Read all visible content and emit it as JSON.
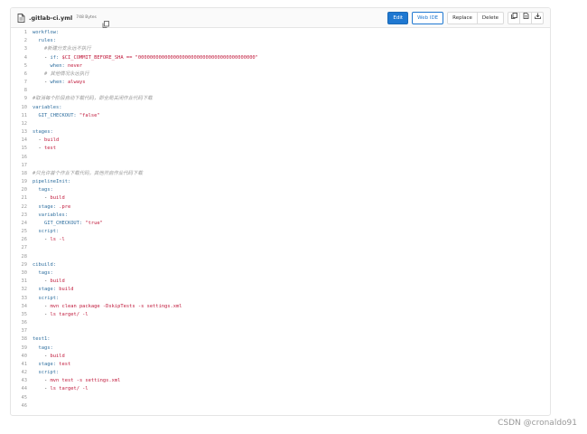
{
  "file": {
    "name": ".gitlab-ci.yml",
    "size": "748 Bytes"
  },
  "toolbar": {
    "edit_label": "Edit",
    "webide_label": "Web IDE",
    "replace_label": "Replace",
    "delete_label": "Delete"
  },
  "code_lines": [
    [
      {
        "t": "workflow:",
        "c": "k"
      }
    ],
    [
      {
        "t": "  rules:",
        "c": "k"
      }
    ],
    [
      {
        "t": "    #新建分支永远不执行",
        "c": "c"
      }
    ],
    [
      {
        "t": "    - ",
        "c": "p"
      },
      {
        "t": "if:",
        "c": "k"
      },
      {
        "t": " $CI_COMMIT_BEFORE_SHA == \"0000000000000000000000000000000000000000\"",
        "c": "s"
      }
    ],
    [
      {
        "t": "      when:",
        "c": "k"
      },
      {
        "t": " never",
        "c": "s"
      }
    ],
    [
      {
        "t": "    # 其他情况永远执行",
        "c": "c"
      }
    ],
    [
      {
        "t": "    - ",
        "c": "p"
      },
      {
        "t": "when:",
        "c": "k"
      },
      {
        "t": " always",
        "c": "s"
      }
    ],
    [
      {
        "t": "",
        "c": "p"
      }
    ],
    [
      {
        "t": "#取消每个阶段自动下载代码，即全局关闭作业代码下载",
        "c": "c"
      }
    ],
    [
      {
        "t": "variables:",
        "c": "k"
      }
    ],
    [
      {
        "t": "  GIT_CHECKOUT:",
        "c": "k"
      },
      {
        "t": " \"false\"",
        "c": "s"
      }
    ],
    [
      {
        "t": "",
        "c": "p"
      }
    ],
    [
      {
        "t": "stages:",
        "c": "k"
      }
    ],
    [
      {
        "t": "  - ",
        "c": "p"
      },
      {
        "t": "build",
        "c": "s"
      }
    ],
    [
      {
        "t": "  - ",
        "c": "p"
      },
      {
        "t": "test",
        "c": "s"
      }
    ],
    [
      {
        "t": "",
        "c": "p"
      }
    ],
    [
      {
        "t": "",
        "c": "p"
      }
    ],
    [
      {
        "t": "#只允许首个作业下载代码，其他开启作业代码下载",
        "c": "c"
      }
    ],
    [
      {
        "t": "pipelineInit:",
        "c": "k"
      }
    ],
    [
      {
        "t": "  tags:",
        "c": "k"
      }
    ],
    [
      {
        "t": "    - ",
        "c": "p"
      },
      {
        "t": "build",
        "c": "s"
      }
    ],
    [
      {
        "t": "  stage:",
        "c": "k"
      },
      {
        "t": " .pre",
        "c": "s"
      }
    ],
    [
      {
        "t": "  variables:",
        "c": "k"
      }
    ],
    [
      {
        "t": "    GIT_CHECKOUT:",
        "c": "k"
      },
      {
        "t": " \"true\"",
        "c": "s"
      }
    ],
    [
      {
        "t": "  script:",
        "c": "k"
      }
    ],
    [
      {
        "t": "    - ",
        "c": "p"
      },
      {
        "t": "ls -l",
        "c": "s"
      }
    ],
    [
      {
        "t": "",
        "c": "p"
      }
    ],
    [
      {
        "t": "",
        "c": "p"
      }
    ],
    [
      {
        "t": "cibuild:",
        "c": "k"
      }
    ],
    [
      {
        "t": "  tags:",
        "c": "k"
      }
    ],
    [
      {
        "t": "    - ",
        "c": "p"
      },
      {
        "t": "build",
        "c": "s"
      }
    ],
    [
      {
        "t": "  stage:",
        "c": "k"
      },
      {
        "t": " build",
        "c": "s"
      }
    ],
    [
      {
        "t": "  script:",
        "c": "k"
      }
    ],
    [
      {
        "t": "    - ",
        "c": "p"
      },
      {
        "t": "mvn clean package -DskipTests -s settings.xml",
        "c": "s"
      }
    ],
    [
      {
        "t": "    - ",
        "c": "p"
      },
      {
        "t": "ls target/ -l",
        "c": "s"
      }
    ],
    [
      {
        "t": "",
        "c": "p"
      }
    ],
    [
      {
        "t": "",
        "c": "p"
      }
    ],
    [
      {
        "t": "test1:",
        "c": "k"
      }
    ],
    [
      {
        "t": "  tags:",
        "c": "k"
      }
    ],
    [
      {
        "t": "    - ",
        "c": "p"
      },
      {
        "t": "build",
        "c": "s"
      }
    ],
    [
      {
        "t": "  stage:",
        "c": "k"
      },
      {
        "t": " test",
        "c": "s"
      }
    ],
    [
      {
        "t": "  script:",
        "c": "k"
      }
    ],
    [
      {
        "t": "    - ",
        "c": "p"
      },
      {
        "t": "mvn test -s settings.xml",
        "c": "s"
      }
    ],
    [
      {
        "t": "    - ",
        "c": "p"
      },
      {
        "t": "ls target/ -l",
        "c": "s"
      }
    ],
    [
      {
        "t": "",
        "c": "p"
      }
    ],
    [
      {
        "t": "",
        "c": "p"
      }
    ]
  ],
  "watermark": "CSDN @cronaldo91",
  "colors": {
    "primary": "#1f78d1",
    "key": "#2f6f9f",
    "string": "#c0193b",
    "comment": "#999999"
  },
  "icons": [
    "file-icon",
    "copy-icon",
    "copy-source-icon",
    "raw-file-icon",
    "download-icon"
  ]
}
